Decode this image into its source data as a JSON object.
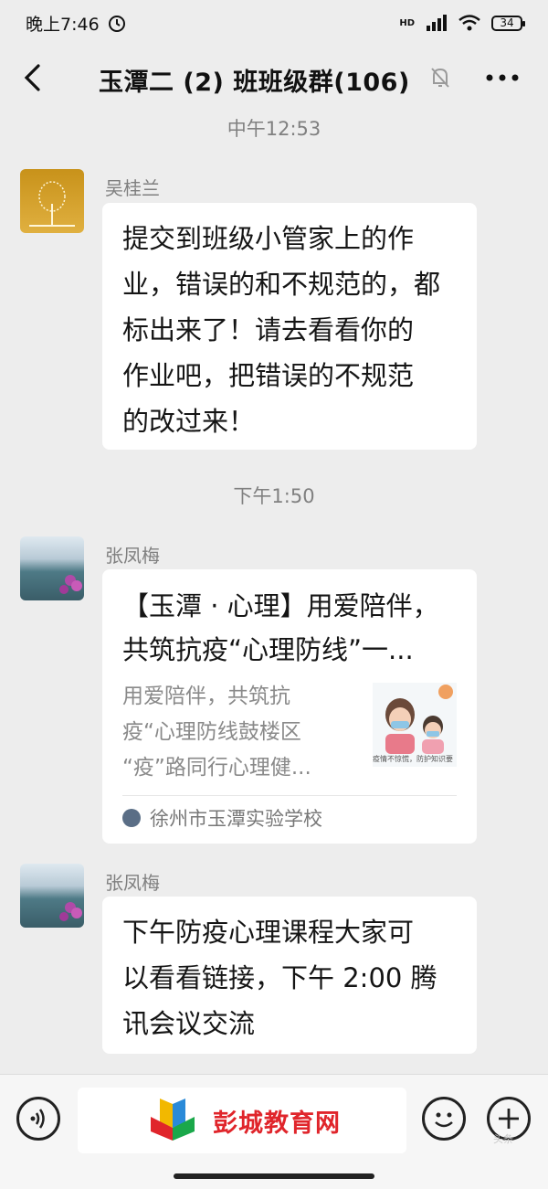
{
  "status_bar": {
    "time": "晚上7:46",
    "network": "HD",
    "battery": "34"
  },
  "header": {
    "title": "玉潭二 (2) 班班级群(106)"
  },
  "messages": [
    {
      "timestamp": "中午12:53",
      "sender": "吴桂兰",
      "lines": [
        "提交到班级小管家上的作",
        "业，错误的和不规范的，都",
        "标出来了！请去看看你的",
        "作业吧，把错误的不规范",
        "的改过来！"
      ]
    },
    {
      "timestamp": "下午1:50",
      "sender": "张凤梅",
      "card": {
        "title_line1": "【玉潭 · 心理】用爱陪伴，",
        "title_line2": "共筑抗疫“心理防线”一...",
        "desc_line1": "用爱陪伴，共筑抗",
        "desc_line2": "疫“心理防线鼓楼区",
        "desc_line3": "“疫”路同行心理健...",
        "thumb_caption": "疫情不惊慌，防护知识要",
        "source": "徐州市玉潭实验学校"
      }
    },
    {
      "sender": "张凤梅",
      "lines": [
        "下午防疫心理课程大家可",
        "以看看链接，下午 2:00 腾",
        "讯会议交流"
      ]
    }
  ],
  "input_bar": {
    "logo_text": "彭城教育网",
    "watermark": "头条"
  },
  "colors": {
    "background": "#ededed",
    "bubble": "#ffffff",
    "logo_red": "#e0252b"
  }
}
